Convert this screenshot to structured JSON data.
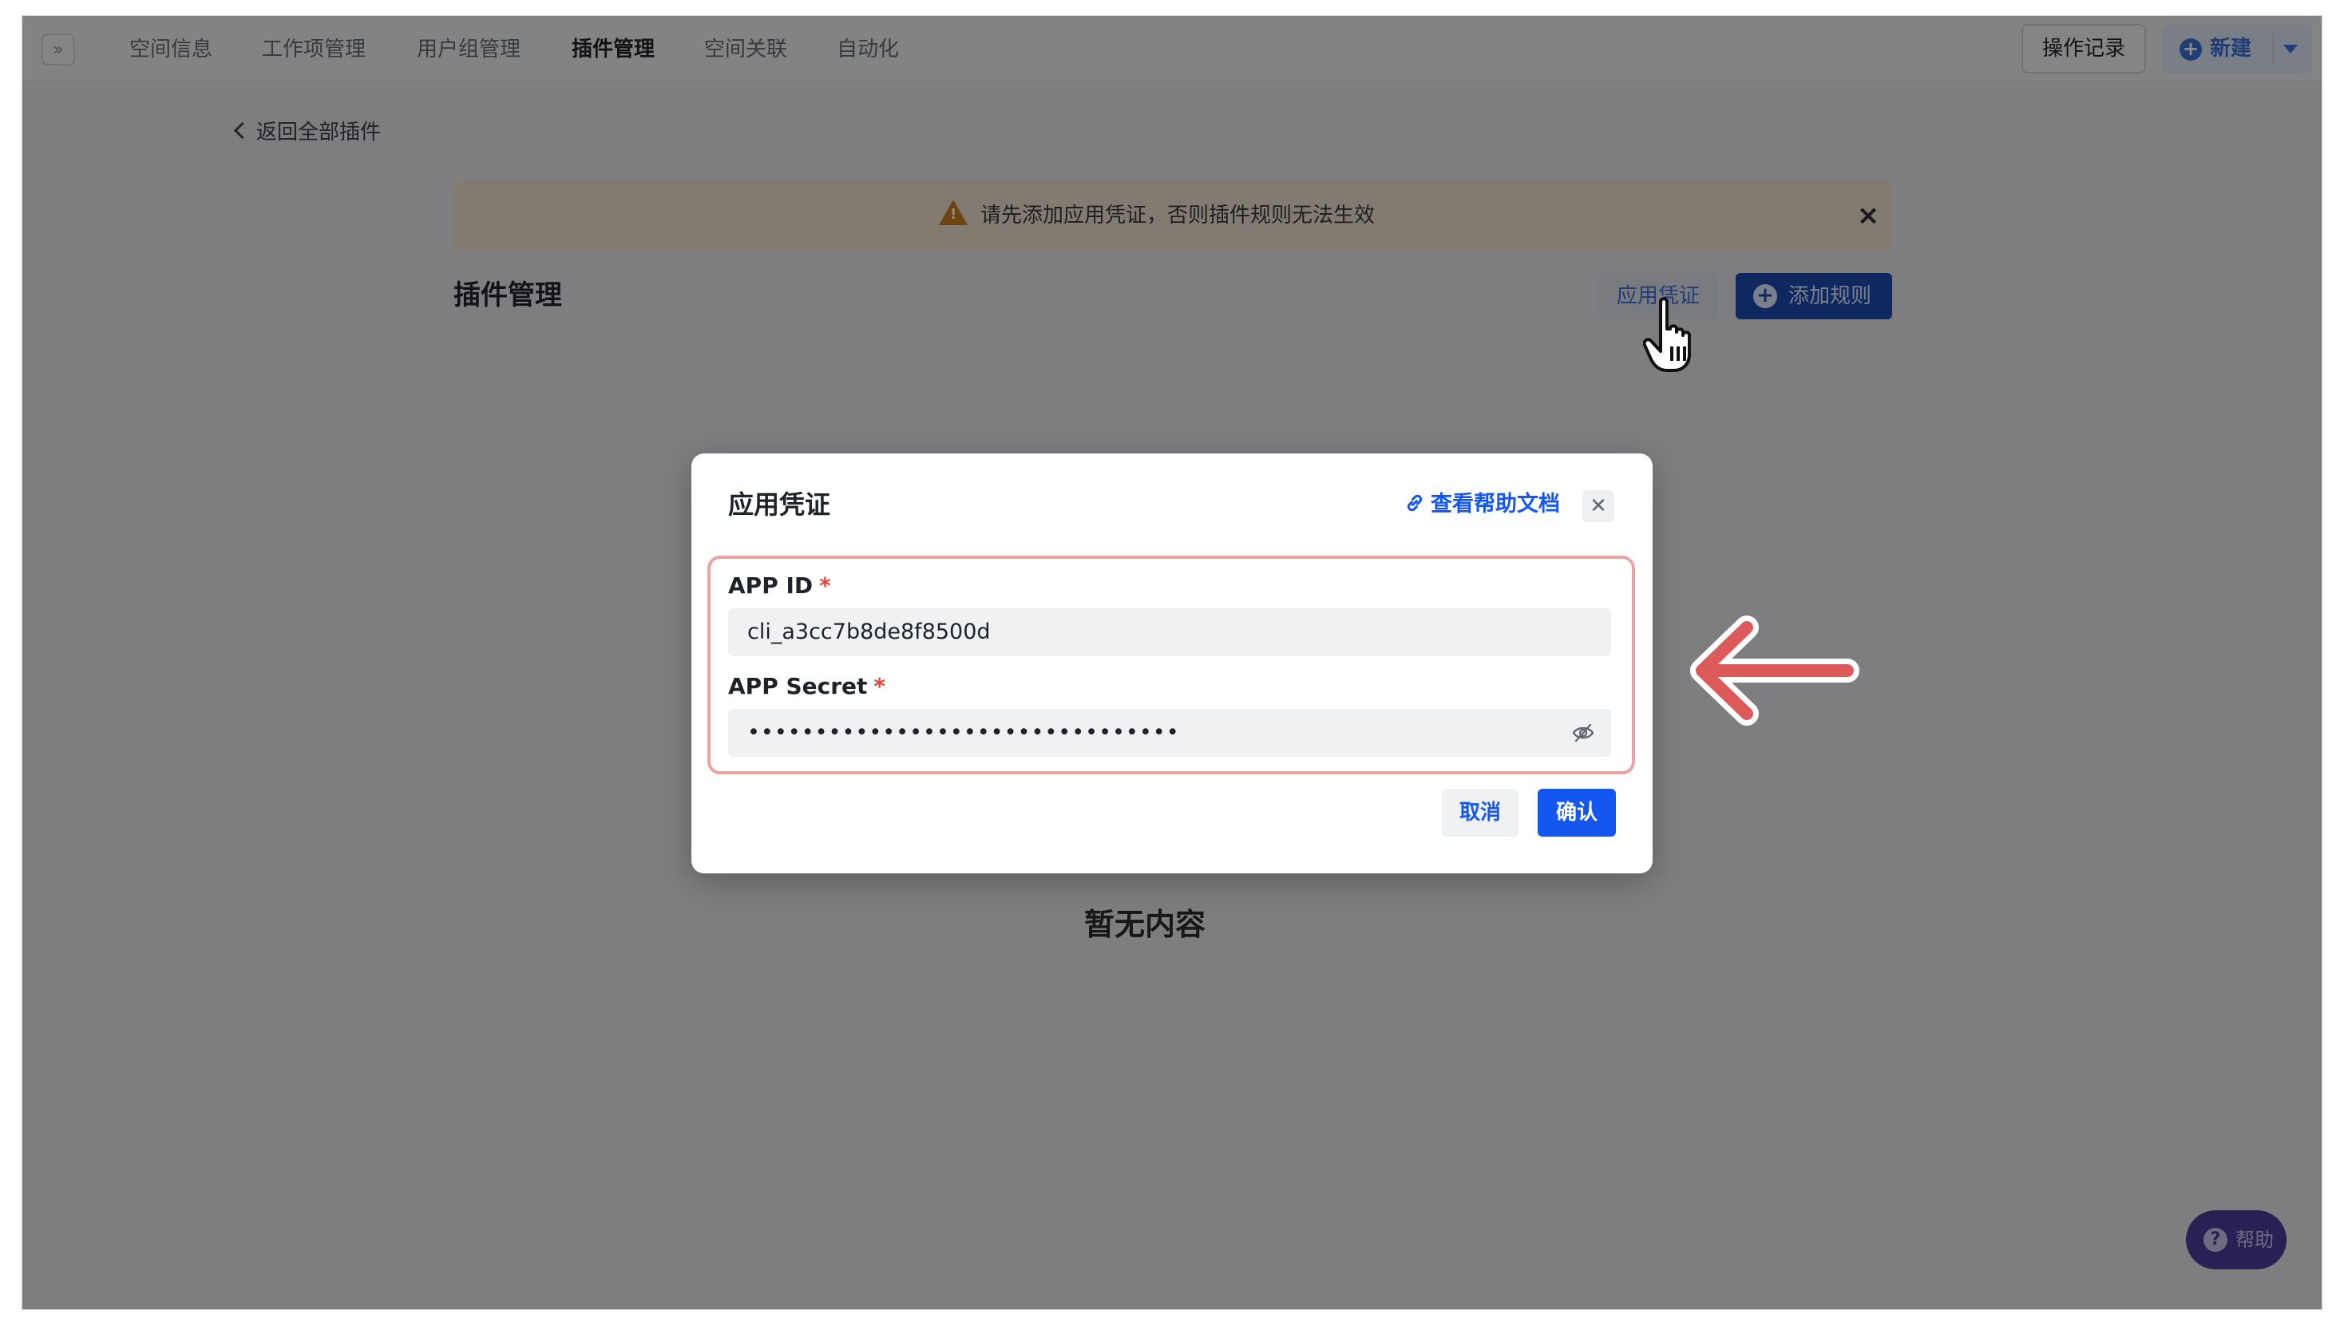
{
  "nav": {
    "collapse_glyph": "»",
    "tabs": [
      {
        "label": "空间信息",
        "active": false
      },
      {
        "label": "工作项管理",
        "active": false
      },
      {
        "label": "用户组管理",
        "active": false
      },
      {
        "label": "插件管理",
        "active": true
      },
      {
        "label": "空间关联",
        "active": false
      },
      {
        "label": "自动化",
        "active": false
      }
    ],
    "ops_label": "操作记录",
    "new_label": "新建"
  },
  "page": {
    "back_label": "返回全部插件",
    "banner_text": "请先添加应用凭证，否则插件规则无法生效",
    "section_title": "插件管理",
    "credentials_label": "应用凭证",
    "add_rule_label": "添加规则",
    "empty_text": "暂无内容",
    "help_label": "帮助"
  },
  "modal": {
    "title": "应用凭证",
    "help_doc_label": "查看帮助文档",
    "app_id_label": "APP ID",
    "app_id_value": "cli_a3cc7b8de8f8500d",
    "app_secret_label": "APP Secret",
    "app_secret_value": "••••••••••••••••••••••••••••••••",
    "required_mark": "*",
    "cancel_label": "取消",
    "confirm_label": "确认"
  },
  "colors": {
    "accent": "#1456f0",
    "annotation_red": "#dc5a5a",
    "warning": "#c67a1e",
    "help_purple": "#4c3d9a"
  }
}
